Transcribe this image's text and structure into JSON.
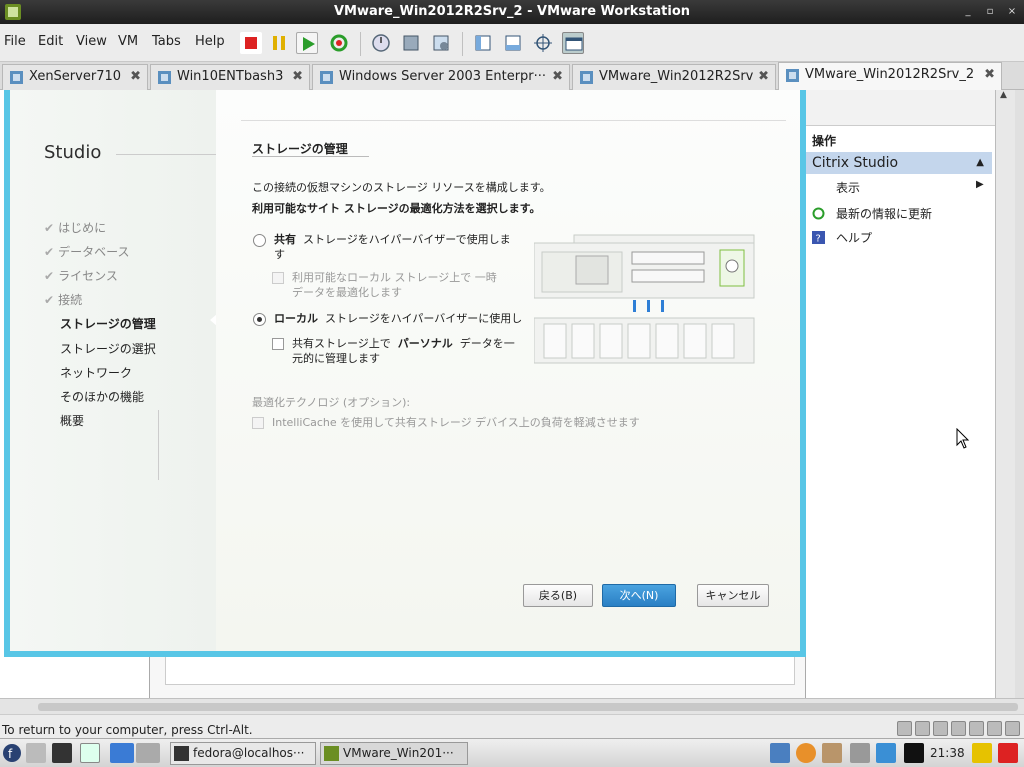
{
  "window": {
    "title": "VMware_Win2012R2Srv_2 - VMware Workstation",
    "minimize": "_",
    "restore": "▫",
    "close": "×"
  },
  "menu": {
    "items": [
      "File",
      "Edit",
      "View",
      "VM",
      "Tabs",
      "Help"
    ]
  },
  "tabs": [
    {
      "label": "XenServer710"
    },
    {
      "label": "Win10ENTbash3"
    },
    {
      "label": "Windows Server 2003 Enterpr···"
    },
    {
      "label": "VMware_Win2012R2Srv"
    },
    {
      "label": "VMware_Win2012R2Srv_2"
    }
  ],
  "tab_close": "✖",
  "right_panel": {
    "header": "操作",
    "section": "Citrix Studio",
    "items": [
      "表示",
      "最新の情報に更新",
      "ヘルプ"
    ]
  },
  "wizard": {
    "brand": "Studio",
    "steps": [
      {
        "label": "はじめに",
        "done": true
      },
      {
        "label": "データベース",
        "done": true
      },
      {
        "label": "ライセンス",
        "done": true
      },
      {
        "label": "接続",
        "done": true
      },
      {
        "label": "ストレージの管理",
        "current": true
      },
      {
        "label": "ストレージの選択"
      },
      {
        "label": "ネットワーク"
      },
      {
        "label": "そのほかの機能"
      },
      {
        "label": "概要"
      }
    ],
    "check_glyph": "✔",
    "title": "ストレージの管理",
    "intro": "この接続の仮想マシンのストレージ リソースを構成します。",
    "question": "利用可能なサイト ストレージの最適化方法を選択します。",
    "option_shared_bold": "共有",
    "option_shared_text_1": "ストレージをハイパーバイザーで使用しま",
    "option_shared_text_2": "す",
    "shared_sub_1": "利用可能なローカル ストレージ上で 一時",
    "shared_sub_2": "データを最適化します",
    "option_local_bold": "ローカル",
    "option_local_text": "ストレージをハイパーバイザーに使用し",
    "local_sub_1a": "共有ストレージ上で",
    "local_sub_1b": "パーソナル",
    "local_sub_1c": "データを一",
    "local_sub_2": "元的に管理します",
    "optimization_header": "最適化テクノロジ (オプション):",
    "intellicache": "IntelliCache を使用して共有ストレージ デバイス上の負荷を軽減させます",
    "buttons": {
      "back": "戻る(B)",
      "next": "次へ(N)",
      "cancel": "キャンセル"
    }
  },
  "status": {
    "message": "To return to your computer, press Ctrl-Alt."
  },
  "taskbar": {
    "tasks": [
      "fedora@localhos···",
      "VMware_Win201···"
    ],
    "clock": "21:38"
  }
}
